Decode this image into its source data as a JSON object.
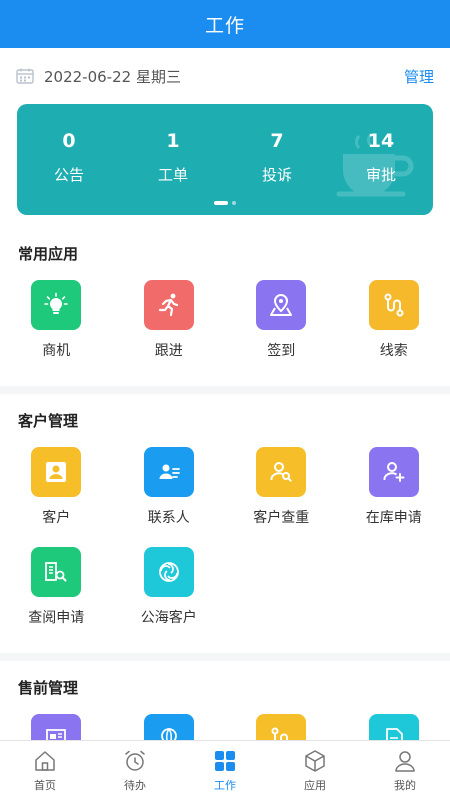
{
  "header": {
    "title": "工作"
  },
  "datebar": {
    "date": "2022-06-22 星期三",
    "manage_label": "管理"
  },
  "stats": [
    {
      "value": "0",
      "label": "公告"
    },
    {
      "value": "1",
      "label": "工单"
    },
    {
      "value": "7",
      "label": "投诉"
    },
    {
      "value": "14",
      "label": "审批"
    }
  ],
  "sections": {
    "common": {
      "title": "常用应用",
      "items": [
        {
          "label": "商机",
          "icon": "bulb-icon",
          "color": "#1ec97c"
        },
        {
          "label": "跟进",
          "icon": "runner-icon",
          "color": "#f26b6b"
        },
        {
          "label": "签到",
          "icon": "map-pin-icon",
          "color": "#8a74f0"
        },
        {
          "label": "线索",
          "icon": "route-icon",
          "color": "#f6b92b"
        }
      ]
    },
    "customer": {
      "title": "客户管理",
      "items": [
        {
          "label": "客户",
          "icon": "user-icon",
          "color": "#f6bf2a"
        },
        {
          "label": "联系人",
          "icon": "contact-card-icon",
          "color": "#1a9df0"
        },
        {
          "label": "客户查重",
          "icon": "user-search-icon",
          "color": "#f6bf2a"
        },
        {
          "label": "在库申请",
          "icon": "user-add-icon",
          "color": "#8a74f0"
        },
        {
          "label": "查阅申请",
          "icon": "document-search-icon",
          "color": "#1ec97c"
        },
        {
          "label": "公海客户",
          "icon": "ocean-icon",
          "color": "#1ec8d8"
        }
      ]
    },
    "presale": {
      "title": "售前管理",
      "items": [
        {
          "label": "",
          "icon": "newspaper-icon",
          "color": "#8a74f0"
        },
        {
          "label": "",
          "icon": "balloon-icon",
          "color": "#1a9df0"
        },
        {
          "label": "",
          "icon": "route-icon",
          "color": "#f6bf2a"
        },
        {
          "label": "",
          "icon": "file-icon",
          "color": "#1ec8d8"
        }
      ]
    }
  },
  "tabbar": [
    {
      "label": "首页",
      "icon": "home-icon"
    },
    {
      "label": "待办",
      "icon": "alarm-clock-icon"
    },
    {
      "label": "工作",
      "icon": "grid-icon",
      "active": true
    },
    {
      "label": "应用",
      "icon": "cube-icon"
    },
    {
      "label": "我的",
      "icon": "person-icon"
    }
  ],
  "colors": {
    "primary": "#1b8cf0",
    "card": "#1eaeb2"
  }
}
